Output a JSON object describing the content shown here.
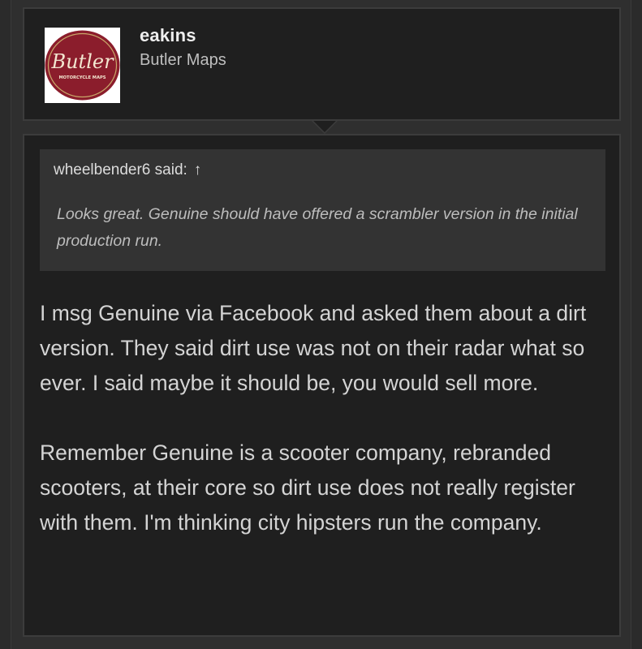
{
  "author": {
    "username": "eakins",
    "title": "Butler Maps",
    "avatar": {
      "brand": "Butler",
      "tagline": "MOTORCYCLE MAPS",
      "color": "#8b1d2c"
    }
  },
  "quote": {
    "author_label": "wheelbender6 said:",
    "jump_icon": "arrow-up-icon",
    "jump_glyph": "↑",
    "text": "Looks great. Genuine should have offered a scrambler version in the initial production run."
  },
  "post": {
    "paragraphs": [
      "I msg Genuine via Facebook and asked them about a dirt version. They said dirt use was not on their radar what so ever. I said maybe it should be, you would sell more.",
      "Remember Genuine is a scooter company, rebranded scooters, at their core so dirt use does not really register with them. I'm thinking city hipsters run the company."
    ]
  }
}
